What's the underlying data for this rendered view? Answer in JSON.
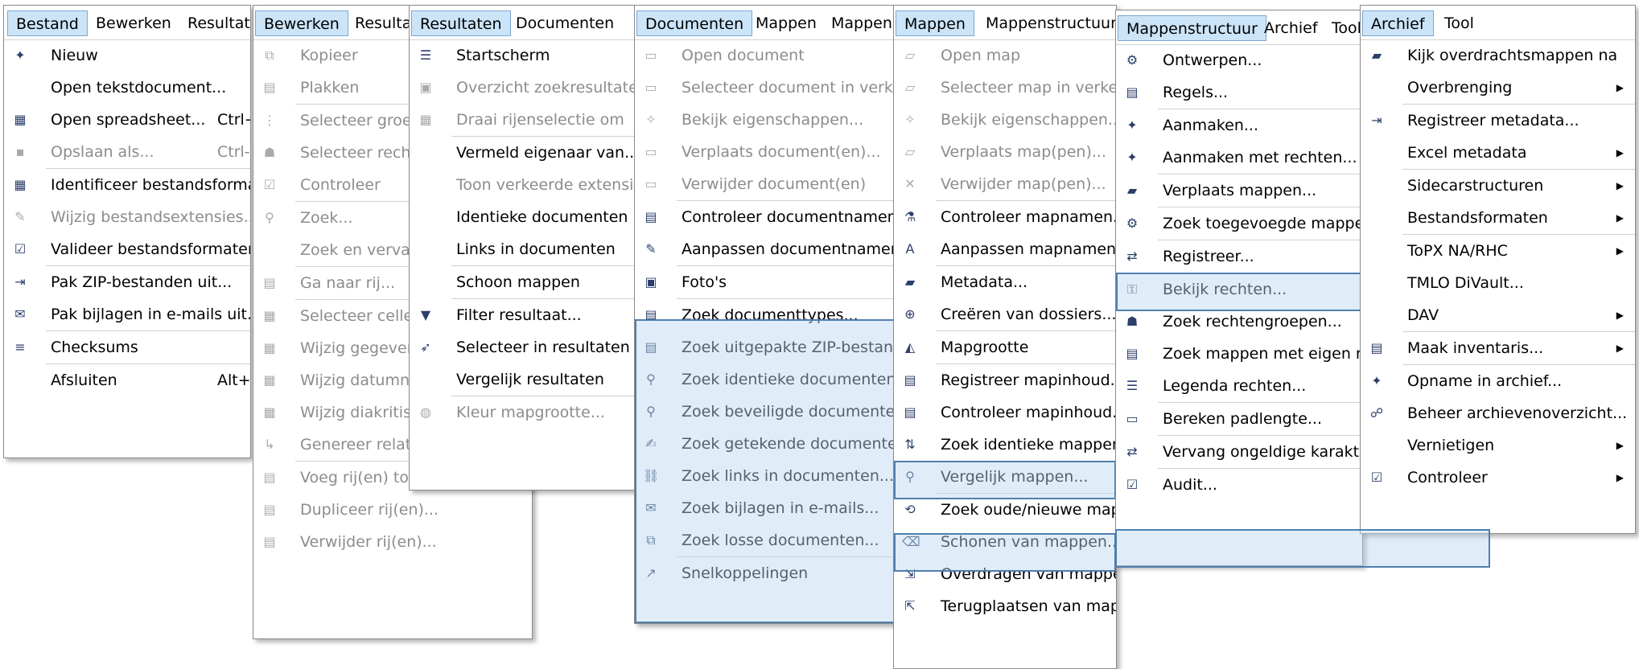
{
  "colors": {
    "highlight_border": "#4f7fae",
    "highlight_fill": "#c9dcef",
    "active_tab": "#cce4f7",
    "disabled_text": "#8c8c8c"
  },
  "panels": [
    {
      "key": "bestand",
      "tabs": [
        {
          "label": "Bestand",
          "active": true
        },
        {
          "label": "Bewerken"
        },
        {
          "label": "Resultaten"
        }
      ],
      "items": [
        {
          "label": "Nieuw",
          "icon": "new-document-icon",
          "glyph": "✦"
        },
        {
          "label": "Open tekstdocument..."
        },
        {
          "label": "Open spreadsheet...",
          "shortcut": "Ctrl+",
          "icon": "spreadsheet-icon",
          "glyph": "▦"
        },
        {
          "label": "Opslaan als...",
          "shortcut": "Ctrl-",
          "icon": "save-icon",
          "glyph": "▪",
          "disabled": true
        },
        {
          "sep": true
        },
        {
          "label": "Identificeer bestandsformaten",
          "icon": "identify-icon",
          "glyph": "▦"
        },
        {
          "label": "Wijzig bestandsextensies...",
          "icon": "edit-extension-icon",
          "glyph": "✎",
          "disabled": true
        },
        {
          "label": "Valideer bestandsformaten",
          "icon": "validate-icon",
          "glyph": "☑"
        },
        {
          "sep": true
        },
        {
          "label": "Pak ZIP-bestanden uit...",
          "icon": "unzip-icon",
          "glyph": "⇥"
        },
        {
          "label": "Pak bijlagen in e-mails uit...",
          "icon": "attachment-icon",
          "glyph": "✉"
        },
        {
          "sep": true
        },
        {
          "label": "Checksums",
          "icon": "checksum-icon",
          "glyph": "≡"
        },
        {
          "sep": true
        },
        {
          "label": "Afsluiten",
          "shortcut": "Alt+"
        }
      ]
    },
    {
      "key": "bewerken",
      "tabs": [
        {
          "label": "Bewerken",
          "active": true
        },
        {
          "label": "Resultaten"
        }
      ],
      "items": [
        {
          "label": "Kopieer",
          "icon": "copy-icon",
          "glyph": "⧉",
          "disabled": true
        },
        {
          "label": "Plakken",
          "icon": "paste-icon",
          "glyph": "▤",
          "disabled": true
        },
        {
          "sep": true
        },
        {
          "label": "Selecteer groepen",
          "icon": "select-group-icon",
          "glyph": "⋮",
          "disabled": true
        },
        {
          "label": "Selecteer rechten",
          "icon": "select-rights-icon",
          "glyph": "☗",
          "disabled": true
        },
        {
          "label": "Controleer",
          "icon": "check-icon",
          "glyph": "☑",
          "disabled": true
        },
        {
          "sep": true
        },
        {
          "label": "Zoek...",
          "icon": "search-icon",
          "glyph": "⚲",
          "disabled": true
        },
        {
          "label": "Zoek en vervang",
          "disabled": true
        },
        {
          "sep": true
        },
        {
          "label": "Ga naar rij...",
          "icon": "goto-row-icon",
          "glyph": "▤",
          "disabled": true
        },
        {
          "sep": true
        },
        {
          "label": "Selecteer cellen",
          "icon": "select-cells-icon",
          "glyph": "▦",
          "disabled": true
        },
        {
          "label": "Wijzig gegevens",
          "icon": "edit-data-icon",
          "glyph": "▦",
          "disabled": true
        },
        {
          "label": "Wijzig datumnotatie",
          "icon": "edit-date-icon",
          "glyph": "▦",
          "disabled": true
        },
        {
          "label": "Wijzig diakritische tekens",
          "icon": "edit-diacritics-icon",
          "glyph": "▦",
          "disabled": true
        },
        {
          "label": "Genereer relatief path...",
          "icon": "relative-path-icon",
          "glyph": "↳",
          "disabled": true
        },
        {
          "sep": true
        },
        {
          "label": "Voeg rij(en) toe...",
          "icon": "add-row-icon",
          "glyph": "▤",
          "disabled": true
        },
        {
          "label": "Dupliceer rij(en)...",
          "icon": "duplicate-row-icon",
          "glyph": "▤",
          "disabled": true
        },
        {
          "label": "Verwijder rij(en)...",
          "icon": "delete-row-icon",
          "glyph": "▤",
          "disabled": true
        }
      ]
    },
    {
      "key": "resultaten",
      "tabs": [
        {
          "label": "Resultaten",
          "active": true
        },
        {
          "label": "Documenten"
        }
      ],
      "items": [
        {
          "label": "Startscherm",
          "icon": "home-list-icon",
          "glyph": "☰"
        },
        {
          "label": "Overzicht zoekresultaten...",
          "icon": "overview-icon",
          "glyph": "▣",
          "disabled": true
        },
        {
          "label": "Draai rijenselectie om",
          "icon": "invert-selection-icon",
          "glyph": "▦",
          "disabled": true
        },
        {
          "sep": true
        },
        {
          "label": "Vermeld eigenaar van..."
        },
        {
          "label": "Toon verkeerde extensies",
          "disabled": true
        },
        {
          "label": "Identieke documenten"
        },
        {
          "label": "Links in documenten"
        },
        {
          "sep": true
        },
        {
          "label": "Schoon mappen"
        },
        {
          "sep": true
        },
        {
          "label": "Filter resultaat...",
          "icon": "filter-icon",
          "glyph": "▼"
        },
        {
          "label": "Selecteer in resultaten",
          "icon": "select-pointer-icon",
          "glyph": "➶"
        },
        {
          "label": "Vergelijk resultaten"
        },
        {
          "sep": true
        },
        {
          "label": "Kleur mapgrootte...",
          "icon": "palette-icon",
          "glyph": "◍",
          "disabled": true
        }
      ]
    },
    {
      "key": "documenten",
      "tabs": [
        {
          "label": "Documenten",
          "active": true
        },
        {
          "label": "Mappen"
        },
        {
          "label": "Mappenstructuur"
        }
      ],
      "items": [
        {
          "label": "Open document",
          "icon": "open-document-icon",
          "glyph": "▭",
          "disabled": true
        },
        {
          "label": "Selecteer document in verkenner",
          "icon": "select-document-icon",
          "glyph": "▭",
          "disabled": true
        },
        {
          "label": "Bekijk eigenschappen...",
          "icon": "properties-icon",
          "glyph": "✧",
          "disabled": true
        },
        {
          "label": "Verplaats document(en)...",
          "icon": "move-document-icon",
          "glyph": "▭",
          "disabled": true
        },
        {
          "label": "Verwijder document(en)",
          "icon": "delete-document-icon",
          "glyph": "▭",
          "disabled": true
        },
        {
          "sep": true
        },
        {
          "label": "Controleer documentnamen...",
          "icon": "check-names-icon",
          "glyph": "▤"
        },
        {
          "label": "Aanpassen documentnamen...",
          "icon": "rename-icon",
          "glyph": "✎"
        },
        {
          "sep": true
        },
        {
          "label": "Foto's",
          "icon": "photos-icon",
          "glyph": "▣"
        },
        {
          "sep": true
        },
        {
          "label": "Zoek documenttypes...",
          "icon": "doc-types-icon",
          "glyph": "▤"
        },
        {
          "label": "Zoek uitgepakte ZIP-bestanden...",
          "icon": "zip-search-icon",
          "glyph": "▤"
        },
        {
          "label": "Zoek identieke documenten...",
          "icon": "identical-docs-icon",
          "glyph": "⚲"
        },
        {
          "label": "Zoek beveiligde documenten...",
          "icon": "secured-docs-icon",
          "glyph": "⚲"
        },
        {
          "label": "Zoek getekende documenten...",
          "icon": "signed-docs-icon",
          "glyph": "✍"
        },
        {
          "label": "Zoek links in documenten...",
          "icon": "links-icon",
          "glyph": "⛓"
        },
        {
          "label": "Zoek bijlagen in e-mails...",
          "icon": "email-attachments-icon",
          "glyph": "✉"
        },
        {
          "label": "Zoek losse documenten...",
          "icon": "loose-docs-icon",
          "glyph": "⧉"
        },
        {
          "sep": true
        },
        {
          "label": "Snelkoppelingen",
          "icon": "shortcut-icon",
          "glyph": "↗"
        }
      ]
    },
    {
      "key": "mappen",
      "tabs": [
        {
          "label": "Mappen",
          "active": true
        },
        {
          "label": "Mappenstructuur"
        }
      ],
      "items": [
        {
          "label": "Open map",
          "icon": "open-folder-icon",
          "glyph": "▱",
          "disabled": true
        },
        {
          "label": "Selecteer map in verkenner",
          "icon": "select-folder-icon",
          "glyph": "▱",
          "disabled": true
        },
        {
          "label": "Bekijk eigenschappen...",
          "icon": "properties-icon",
          "glyph": "✧",
          "disabled": true
        },
        {
          "label": "Verplaats map(pen)...",
          "icon": "move-folder-icon",
          "glyph": "▱",
          "disabled": true
        },
        {
          "label": "Verwijder map(pen)...",
          "icon": "delete-folder-icon",
          "glyph": "✕",
          "disabled": true
        },
        {
          "sep": true
        },
        {
          "label": "Controleer mapnamen...",
          "icon": "check-folder-names-icon",
          "glyph": "⚗"
        },
        {
          "label": "Aanpassen mapnamen...",
          "icon": "rename-folder-icon",
          "glyph": "A"
        },
        {
          "sep": true
        },
        {
          "label": "Metadata...",
          "icon": "metadata-icon",
          "glyph": "▰"
        },
        {
          "label": "Creëren van dossiers...",
          "icon": "create-dossier-icon",
          "glyph": "⊕"
        },
        {
          "sep": true
        },
        {
          "label": "Mapgrootte",
          "icon": "folder-size-icon",
          "glyph": "◭"
        },
        {
          "sep": true
        },
        {
          "label": "Registreer mapinhoud...",
          "icon": "register-content-icon",
          "glyph": "▤"
        },
        {
          "label": "Controleer mapinhoud...",
          "icon": "check-content-icon",
          "glyph": "▤"
        },
        {
          "label": "Zoek identieke mappen...",
          "icon": "identical-folders-icon",
          "glyph": "⇅"
        },
        {
          "label": "Vergelijk mappen...",
          "icon": "compare-folders-icon",
          "glyph": "⚲"
        },
        {
          "sep": true
        },
        {
          "label": "Zoek oude/nieuwe mappen",
          "icon": "old-new-folders-icon",
          "glyph": "⟲"
        },
        {
          "label": "Schonen van mappen...",
          "icon": "clean-folders-icon",
          "glyph": "⌫"
        },
        {
          "label": "Overdragen van mappen...",
          "icon": "transfer-folders-icon",
          "glyph": "⇲"
        },
        {
          "label": "Terugplaatsen van mappen...",
          "icon": "restore-folders-icon",
          "glyph": "⇱"
        }
      ]
    },
    {
      "key": "mappenstructuur",
      "tabs": [
        {
          "label": "Mappenstructuur",
          "active": true
        },
        {
          "label": "Archief"
        },
        {
          "label": "Tool"
        }
      ],
      "items": [
        {
          "label": "Ontwerpen...",
          "icon": "design-icon",
          "glyph": "⚙"
        },
        {
          "label": "Regels...",
          "icon": "rules-icon",
          "glyph": "▤"
        },
        {
          "sep": true
        },
        {
          "label": "Aanmaken...",
          "icon": "create-icon",
          "glyph": "✦"
        },
        {
          "label": "Aanmaken met rechten...",
          "icon": "create-rights-icon",
          "glyph": "✦"
        },
        {
          "sep": true
        },
        {
          "label": "Verplaats mappen...",
          "icon": "move-folders-icon",
          "glyph": "▰"
        },
        {
          "sep": true
        },
        {
          "label": "Zoek toegevoegde mappen/documenten",
          "icon": "added-folders-icon",
          "glyph": "⚙"
        },
        {
          "sep": true
        },
        {
          "label": "Registreer...",
          "icon": "register-icon",
          "glyph": "⇄"
        },
        {
          "sep": true
        },
        {
          "label": "Bekijk rechten...",
          "icon": "lock-icon",
          "glyph": "⚿"
        },
        {
          "label": "Zoek rechtengroepen...",
          "icon": "rights-groups-icon",
          "glyph": "☗"
        },
        {
          "label": "Zoek mappen met eigen rechten",
          "icon": "own-rights-icon",
          "glyph": "▤"
        },
        {
          "label": "Legenda rechten...",
          "icon": "legend-icon",
          "glyph": "☰"
        },
        {
          "sep": true
        },
        {
          "label": "Bereken padlengte...",
          "icon": "path-length-icon",
          "glyph": "▭"
        },
        {
          "sep": true
        },
        {
          "label": "Vervang ongeldige karakters...",
          "icon": "replace-chars-icon",
          "glyph": "⇄"
        },
        {
          "sep": true
        },
        {
          "label": "Audit...",
          "icon": "audit-icon",
          "glyph": "☑"
        }
      ]
    },
    {
      "key": "archief",
      "tabs": [
        {
          "label": "Archief",
          "active": true
        },
        {
          "label": "Tool"
        }
      ],
      "items": [
        {
          "label": "Kijk overdrachtsmappen na",
          "icon": "review-transfer-icon",
          "glyph": "▰"
        },
        {
          "label": "Overbrenging",
          "submenu": true
        },
        {
          "sep": true
        },
        {
          "label": "Registreer metadata...",
          "icon": "register-metadata-icon",
          "glyph": "⇥"
        },
        {
          "label": "Excel metadata",
          "submenu": true
        },
        {
          "sep": true
        },
        {
          "label": "Sidecarstructuren",
          "submenu": true
        },
        {
          "label": "Bestandsformaten",
          "submenu": true
        },
        {
          "sep": true
        },
        {
          "label": "ToPX NA/RHC",
          "submenu": true
        },
        {
          "label": "TMLO DiVault..."
        },
        {
          "label": "DAV",
          "submenu": true
        },
        {
          "sep": true
        },
        {
          "label": "Maak inventaris...",
          "icon": "inventory-icon",
          "glyph": "▤",
          "submenu": true
        },
        {
          "sep": true
        },
        {
          "label": "Opname in archief...",
          "icon": "archive-intake-icon",
          "glyph": "✦"
        },
        {
          "label": "Beheer archievenoverzicht...",
          "icon": "archive-overview-icon",
          "glyph": "☍"
        },
        {
          "label": "Vernietigen",
          "submenu": true
        },
        {
          "label": "Controleer",
          "icon": "check-icon",
          "glyph": "☑",
          "submenu": true
        }
      ]
    }
  ],
  "arrow_glyph": "▶"
}
